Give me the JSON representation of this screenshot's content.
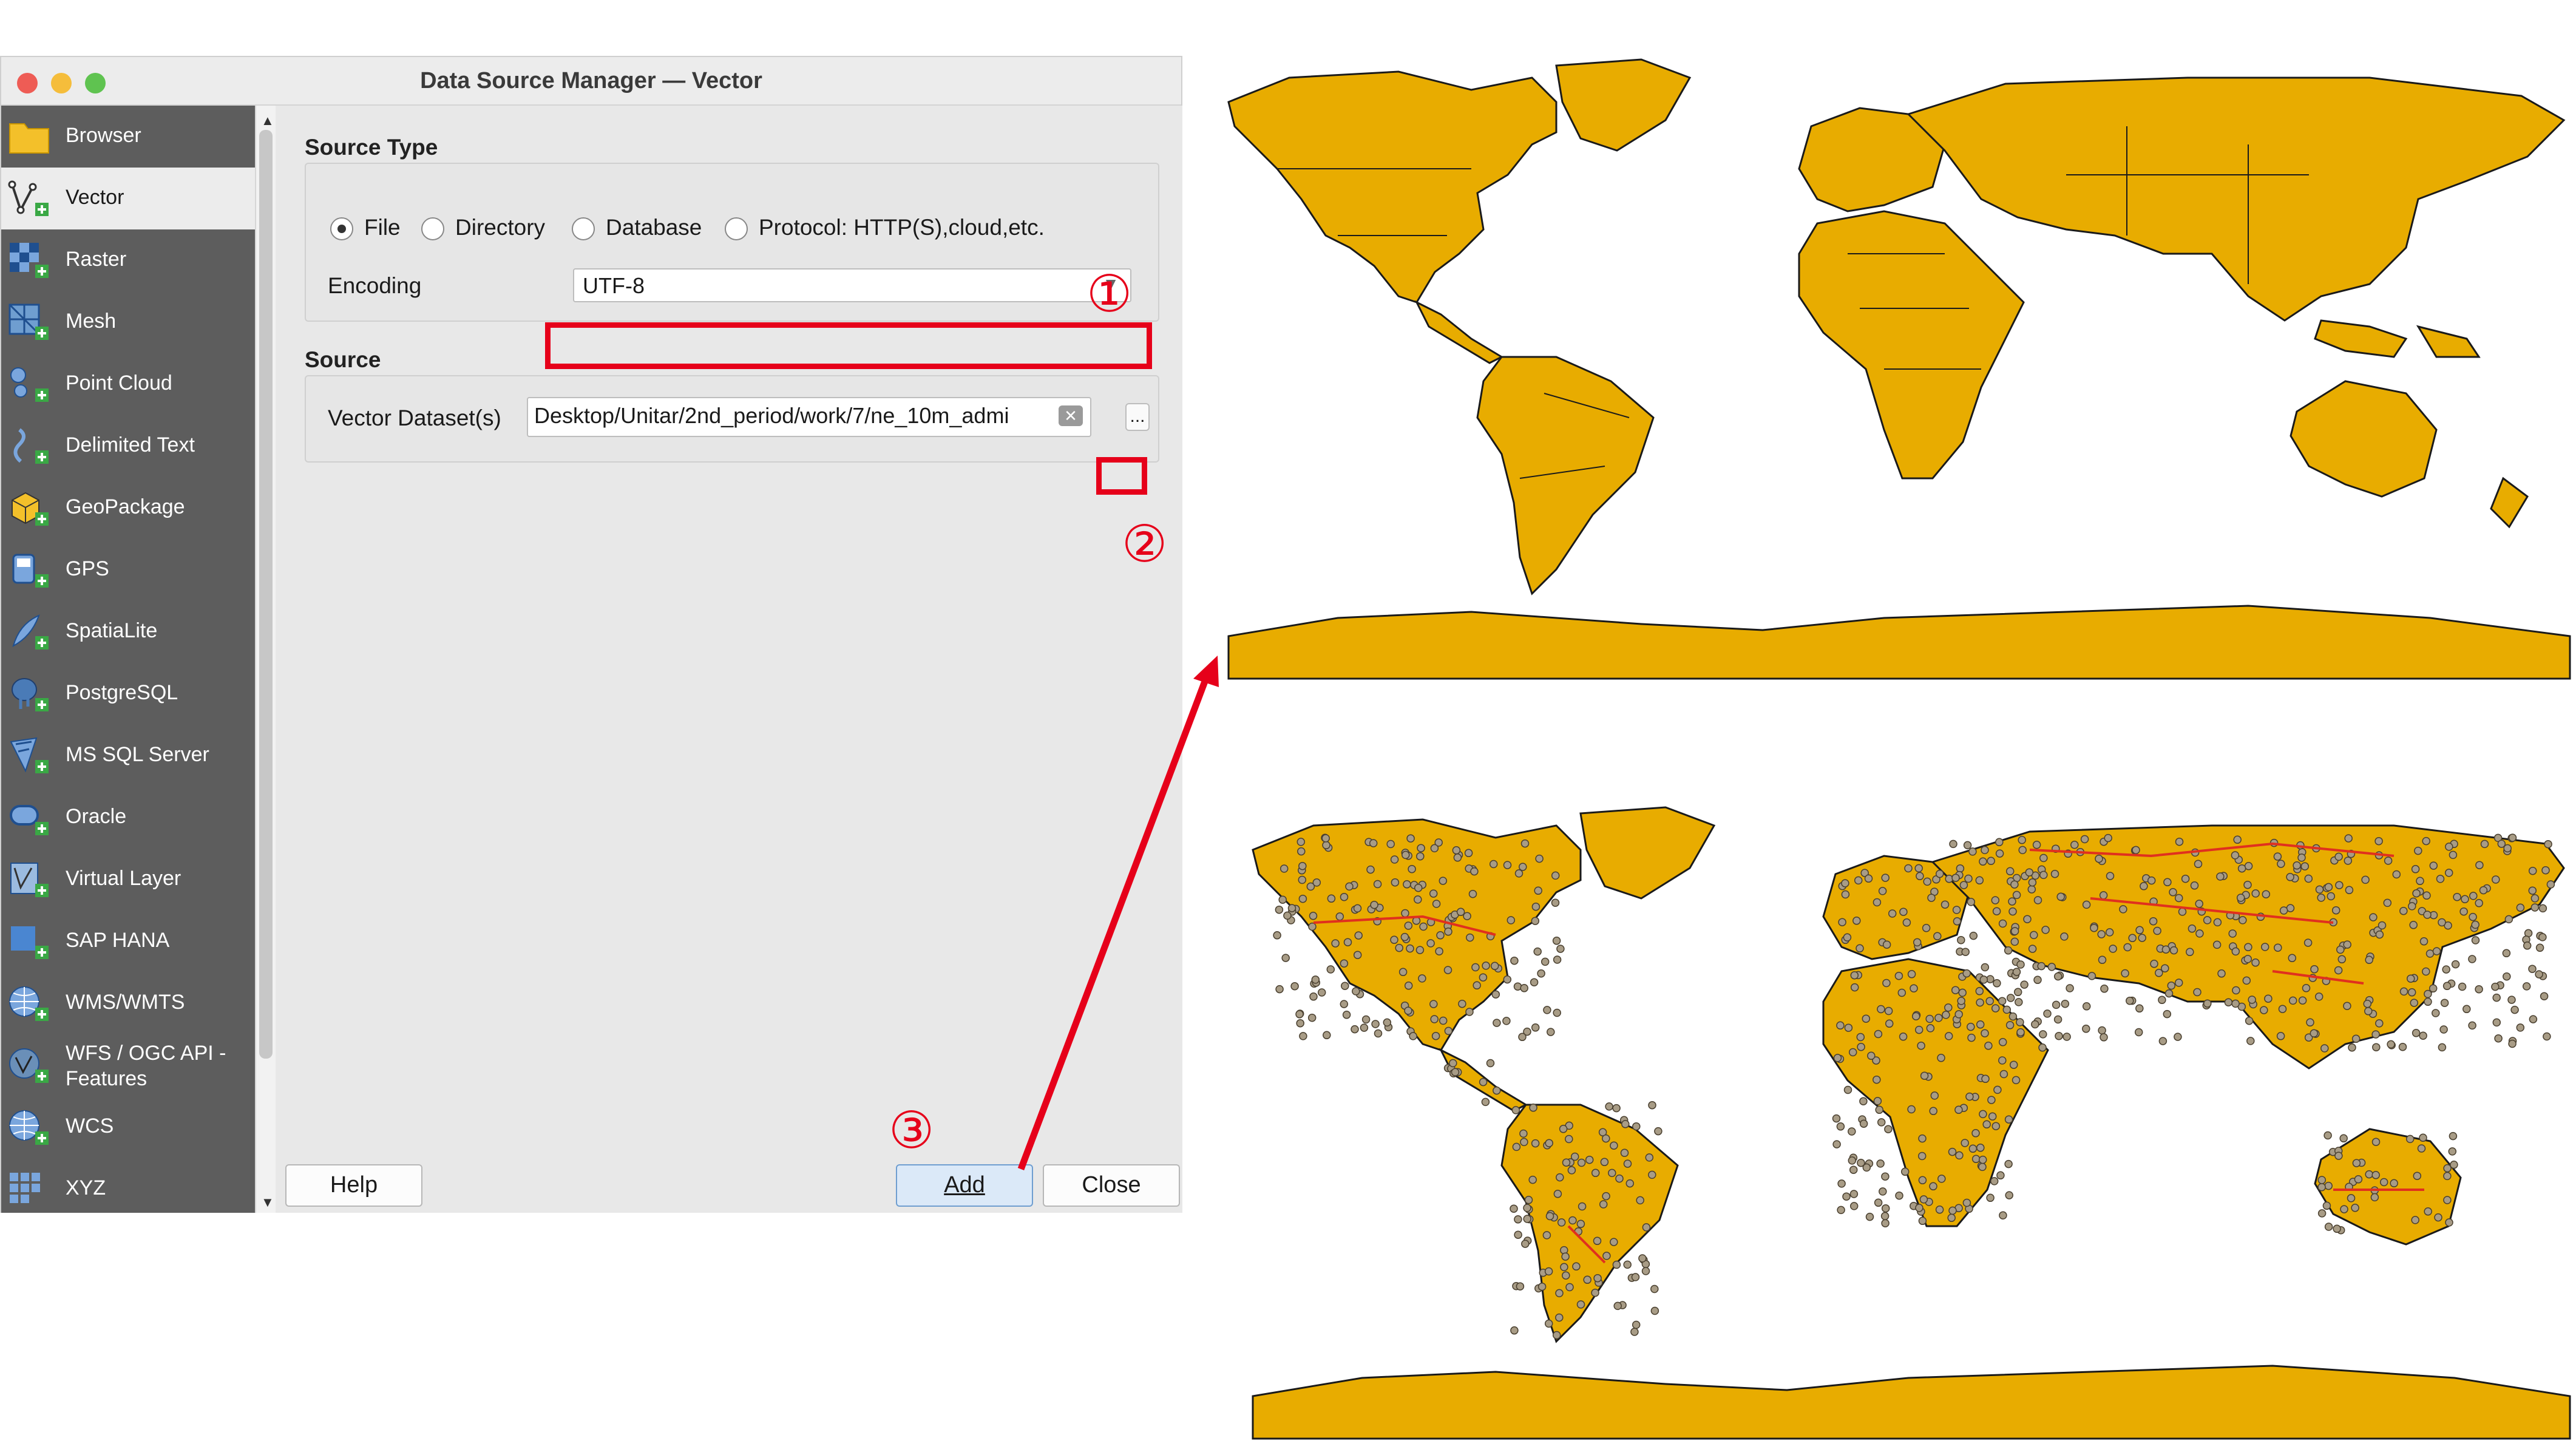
{
  "window": {
    "title": "Data Source Manager — Vector"
  },
  "sidebar": {
    "items": [
      {
        "label": "Browser",
        "icon": "folder-icon"
      },
      {
        "label": "Vector",
        "icon": "vector-icon",
        "active": true
      },
      {
        "label": "Raster",
        "icon": "raster-icon"
      },
      {
        "label": "Mesh",
        "icon": "mesh-icon"
      },
      {
        "label": "Point Cloud",
        "icon": "point-cloud-icon"
      },
      {
        "label": "Delimited Text",
        "icon": "delimited-text-icon"
      },
      {
        "label": "GeoPackage",
        "icon": "geopackage-icon"
      },
      {
        "label": "GPS",
        "icon": "gps-icon"
      },
      {
        "label": "SpatiaLite",
        "icon": "spatialite-icon"
      },
      {
        "label": "PostgreSQL",
        "icon": "postgresql-icon"
      },
      {
        "label": "MS SQL Server",
        "icon": "mssql-icon"
      },
      {
        "label": "Oracle",
        "icon": "oracle-icon"
      },
      {
        "label": "Virtual Layer",
        "icon": "virtual-layer-icon"
      },
      {
        "label": "SAP HANA",
        "icon": "sap-hana-icon"
      },
      {
        "label": "WMS/WMTS",
        "icon": "wms-icon"
      },
      {
        "label_line1": "WFS / OGC API -",
        "label_line2": "Features",
        "icon": "wfs-icon"
      },
      {
        "label": "WCS",
        "icon": "wcs-icon"
      },
      {
        "label": "XYZ",
        "icon": "xyz-icon"
      }
    ]
  },
  "source_type": {
    "heading": "Source Type",
    "options": [
      {
        "label": "File",
        "selected": true
      },
      {
        "label": "Directory",
        "selected": false
      },
      {
        "label": "Database",
        "selected": false
      },
      {
        "label": "Protocol: HTTP(S),cloud,etc.",
        "selected": false
      }
    ],
    "encoding_label": "Encoding",
    "encoding_value": "UTF-8"
  },
  "source": {
    "heading": "Source",
    "dataset_label": "Vector Dataset(s)",
    "dataset_value": "Desktop/Unitar/2nd_period/work/7/ne_10m_admi",
    "browse_label": "..."
  },
  "buttons": {
    "help": "Help",
    "add": "Add",
    "close": "Close"
  },
  "annotations": {
    "step1": "①",
    "step2": "②",
    "step3": "③",
    "color": "#e6001a"
  },
  "colors": {
    "map_fill": "#e8ac00",
    "map_outline": "#1a1a1a",
    "points": "#a89c86",
    "roads": "#e0301e",
    "sidebar": "#5d5d5d"
  }
}
